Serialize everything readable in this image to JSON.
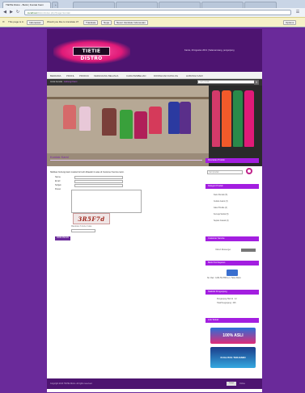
{
  "browser": {
    "tabs": [
      {
        "label": "TIETIE Distro - Butik | Kontak Kami"
      },
      {
        "label": "+"
      }
    ],
    "url": "localhost",
    "url_rest": "/distro/index.php?page=kontak",
    "translate_bar": {
      "message": "This page is in",
      "language": "Indonesian",
      "question": "Would you like to translate it?",
      "translate_button": "Translate",
      "nope_button": "Nope",
      "never_button": "Never translate Indonesian",
      "options_button": "Options"
    }
  },
  "header": {
    "logo_text": "TIETIE DISTRO",
    "date_text": "Kamis, 29 Agustus 2013 | Selamat siang, pengunjung"
  },
  "menu": {
    "items": [
      "BERANDA",
      "PROFIL",
      "PRODUK",
      "KERANJANG BELANJA",
      "CARA PEMBELIAN",
      "DOWNLOAD KATALOG",
      "HUBUNGI KAMI"
    ]
  },
  "breadcrumb": {
    "prefix": "Anda berada :",
    "current": "Hubungi Kami"
  },
  "search_top": {
    "placeholder": "cari produk"
  },
  "content": {
    "title": "Kontak Kami",
    "intro": "Silahkan hubungi kami melalui formulir dibawah ini atau di Customer Service kami.",
    "fields": {
      "nama": "Nama",
      "email": "Email",
      "subjek": "Subjek",
      "pesan": "Pesan"
    },
    "captcha_text": "3R5F7d",
    "captcha_note": "Masukkan 6 kode di atas",
    "submit_label": "KIRIM PESAN"
  },
  "sidebar": {
    "search_title": "Pencarian Produk",
    "search_placeholder": "Cari produk...",
    "category_title": "Kategori Produk",
    "categories": [
      "Kaos Pendek (5)",
      "Celana Jeans (3)",
      "Jaket Hoodie (4)",
      "Kemeja Santai (6)",
      "Sepatu Casual (2)"
    ],
    "cs_title": "Customer Service",
    "cs_label": "Yahoo! Messenger",
    "bank_title": "Bank Pembayaran",
    "bank_line": "No. Rek : 1234-56-7890 a.n. Tietie Distro",
    "visitor_title": "Statistik Pengunjung",
    "visitor_today": "Pengunjung Hari Ini : 12",
    "visitor_total": "Total Pengunjung : 345",
    "link_title": "Link Terkait",
    "promo1_text": "100% ASLI",
    "promo2_text": "KUALITAS TERJAMIN"
  },
  "footer": {
    "text": "Copyright 2013 TIETIE Distro. All rights reserved.",
    "badge": "Yahoo!",
    "right": "Online"
  },
  "colors": {
    "purple": "#6a2a9a",
    "header": "#4d1470",
    "accent": "#a31ee0",
    "pink": "#e01a78"
  }
}
